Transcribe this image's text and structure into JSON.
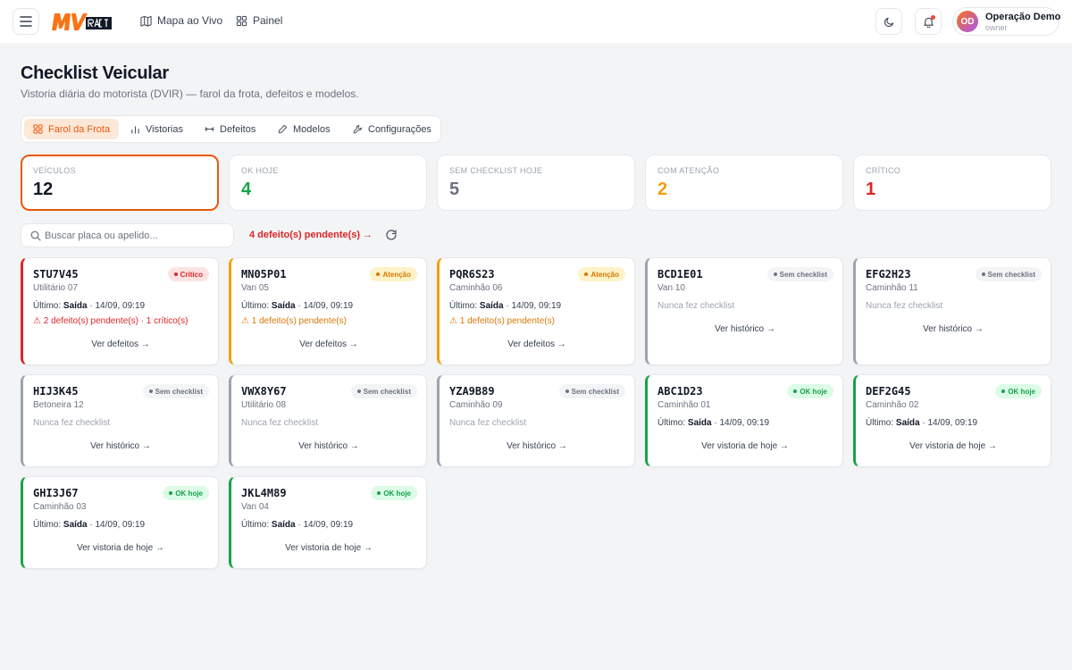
{
  "header": {
    "logo_text": "MV RASTER",
    "nav": [
      {
        "label": "Mapa ao Vivo",
        "icon": "map-icon"
      },
      {
        "label": "Painel",
        "icon": "grid-icon"
      }
    ],
    "user": {
      "initials": "OD",
      "name": "Operação Demo",
      "role": "owner"
    }
  },
  "page": {
    "title": "Checklist Veicular",
    "subtitle": "Vistoria diária do motorista (DVIR) — farol da frota, defeitos e modelos."
  },
  "tabs": [
    {
      "label": "Farol da Frota",
      "icon": "grid-icon",
      "active": true
    },
    {
      "label": "Vistorias",
      "icon": "bar-chart-icon",
      "active": false
    },
    {
      "label": "Defeitos",
      "icon": "wrench-icon",
      "active": false
    },
    {
      "label": "Modelos",
      "icon": "pencil-icon",
      "active": false
    },
    {
      "label": "Configurações",
      "icon": "tool-icon",
      "active": false
    }
  ],
  "stats": [
    {
      "label": "VEÍCULOS",
      "value": "12",
      "color": "#111827"
    },
    {
      "label": "OK HOJE",
      "value": "4",
      "color": "#16a34a"
    },
    {
      "label": "SEM CHECKLIST HOJE",
      "value": "5",
      "color": "#6b7280"
    },
    {
      "label": "COM ATENÇÃO",
      "value": "2",
      "color": "#f59e0b"
    },
    {
      "label": "CRÍTICO",
      "value": "1",
      "color": "#dc2626"
    }
  ],
  "toolbar": {
    "search_placeholder": "Buscar placa ou apelido...",
    "pending_label": "4 defeito(s) pendente(s) →"
  },
  "last_prefix": "Último:",
  "vehicles": [
    {
      "plate": "STU7V45",
      "nick": "Utilitário 07",
      "status": "Crítico",
      "kind": "red",
      "last_type": "Saída",
      "last_time": " · 14/09, 09:19",
      "defect": "⚠ 2 defeito(s) pendente(s) · 1 crítico(s)",
      "action": "Ver defeitos →"
    },
    {
      "plate": "MN05P01",
      "nick": "Van 05",
      "status": "Atenção",
      "kind": "amber",
      "last_type": "Saída",
      "last_time": " · 14/09, 09:19",
      "defect": "⚠ 1 defeito(s) pendente(s)",
      "action": "Ver defeitos →"
    },
    {
      "plate": "PQR6S23",
      "nick": "Caminhão 06",
      "status": "Atenção",
      "kind": "amber",
      "last_type": "Saída",
      "last_time": " · 14/09, 09:19",
      "defect": "⚠ 1 defeito(s) pendente(s)",
      "action": "Ver defeitos →"
    },
    {
      "plate": "BCD1E01",
      "nick": "Van 10",
      "status": "Sem checklist",
      "kind": "gray",
      "never": "Nunca fez checklist",
      "action": "Ver histórico →"
    },
    {
      "plate": "EFG2H23",
      "nick": "Caminhão 11",
      "status": "Sem checklist",
      "kind": "gray",
      "never": "Nunca fez checklist",
      "action": "Ver histórico →"
    },
    {
      "plate": "HIJ3K45",
      "nick": "Betoneira 12",
      "status": "Sem checklist",
      "kind": "gray",
      "never": "Nunca fez checklist",
      "action": "Ver histórico →"
    },
    {
      "plate": "VWX8Y67",
      "nick": "Utilitário 08",
      "status": "Sem checklist",
      "kind": "gray",
      "never": "Nunca fez checklist",
      "action": "Ver histórico →"
    },
    {
      "plate": "YZA9B89",
      "nick": "Caminhão 09",
      "status": "Sem checklist",
      "kind": "gray",
      "never": "Nunca fez checklist",
      "action": "Ver histórico →"
    },
    {
      "plate": "ABC1D23",
      "nick": "Caminhão 01",
      "status": "OK hoje",
      "kind": "green",
      "last_type": "Saída",
      "last_time": " · 14/09, 09:19",
      "action": "Ver vistoria de hoje →"
    },
    {
      "plate": "DEF2G45",
      "nick": "Caminhão 02",
      "status": "OK hoje",
      "kind": "green",
      "last_type": "Saída",
      "last_time": " · 14/09, 09:19",
      "action": "Ver vistoria de hoje →"
    },
    {
      "plate": "GHI3J67",
      "nick": "Caminhão 03",
      "status": "OK hoje",
      "kind": "green",
      "last_type": "Saída",
      "last_time": " · 14/09, 09:19",
      "action": "Ver vistoria de hoje →"
    },
    {
      "plate": "JKL4M89",
      "nick": "Van 04",
      "status": "OK hoje",
      "kind": "green",
      "last_type": "Saída",
      "last_time": " · 14/09, 09:19",
      "action": "Ver vistoria de hoje →"
    }
  ]
}
